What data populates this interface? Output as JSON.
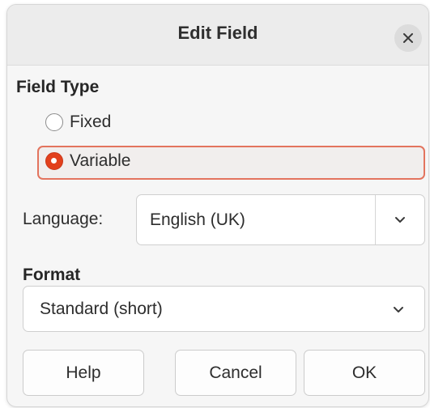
{
  "dialog": {
    "title": "Edit Field",
    "close_icon": "close-icon"
  },
  "field_type": {
    "heading": "Field Type",
    "options": [
      {
        "label": "Fixed",
        "selected": false
      },
      {
        "label": "Variable",
        "selected": true
      }
    ]
  },
  "language": {
    "label": "Language:",
    "value": "English (UK)",
    "dropdown_icon": "chevron-down-icon"
  },
  "format": {
    "heading": "Format",
    "value": "Standard (short)",
    "dropdown_icon": "chevron-down-icon"
  },
  "buttons": {
    "help": "Help",
    "cancel": "Cancel",
    "ok": "OK"
  },
  "colors": {
    "accent": "#e2401c",
    "focus_border": "#e3745e"
  }
}
